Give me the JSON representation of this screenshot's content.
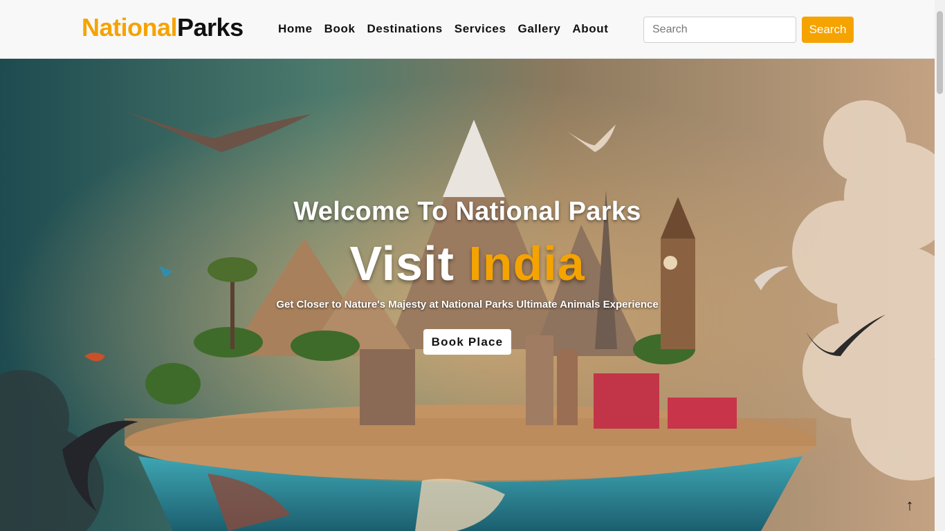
{
  "brand": {
    "part1": "National",
    "part2": "Parks"
  },
  "nav": [
    "Home",
    "Book",
    "Destinations",
    "Services",
    "Gallery",
    "About"
  ],
  "search": {
    "placeholder": "Search",
    "value": "",
    "button_label": "Search"
  },
  "hero": {
    "welcome": "Welcome To National Parks",
    "visit_word": "Visit",
    "country": "India",
    "tagline": "Get Closer to Nature's Majesty at National Parks Ultimate Animals Experience",
    "button_label": "Book Place"
  },
  "back_to_top": "↑",
  "colors": {
    "accent": "#f5a300",
    "nav_bg": "#f8f8f8",
    "text_dark": "#111111"
  }
}
